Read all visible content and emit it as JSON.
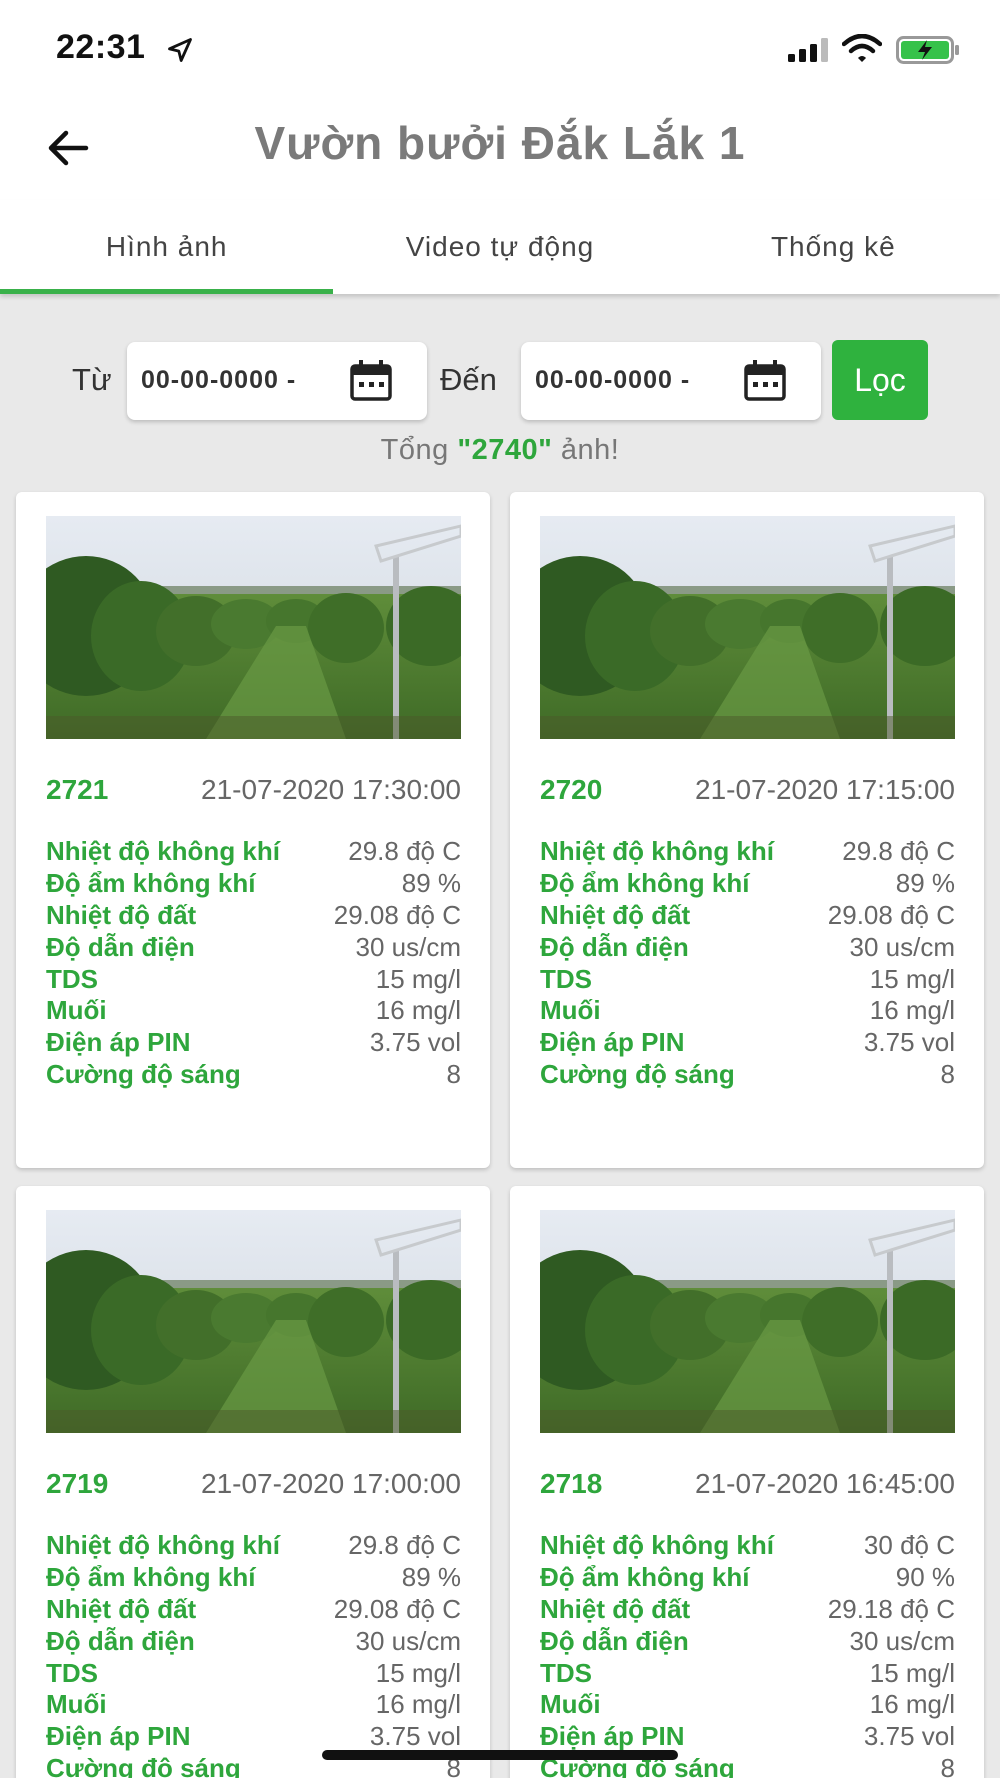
{
  "status_bar": {
    "time": "22:31",
    "icons": [
      "location-arrow-icon",
      "signal-icon",
      "wifi-icon",
      "battery-charging-icon"
    ]
  },
  "header": {
    "title": "Vườn bưởi Đắk Lắk 1",
    "back_icon": "arrow-left-icon"
  },
  "tabs": [
    {
      "label": "Hình ảnh",
      "active": true
    },
    {
      "label": "Video tự động",
      "active": false
    },
    {
      "label": "Thống kê",
      "active": false
    }
  ],
  "filter": {
    "from_label": "Từ",
    "to_label": "Đến",
    "from_value": "00-00-0000 -",
    "to_value": "00-00-0000 -",
    "button_label": "Lọc",
    "accent_color": "#2fb23e"
  },
  "total": {
    "prefix": "Tổng ",
    "count": "\"2740\"",
    "suffix": " ảnh!"
  },
  "cards": [
    {
      "id": "2721",
      "timestamp": "21-07-2020 17:30:00",
      "rows": [
        {
          "key": "Nhiệt độ không khí",
          "value": "29.8 độ C"
        },
        {
          "key": "Độ ẩm không khí",
          "value": "89 %"
        },
        {
          "key": "Nhiệt độ đất",
          "value": "29.08 độ C"
        },
        {
          "key": "Độ dẫn điện",
          "value": "30 us/cm"
        },
        {
          "key": "TDS",
          "value": "15 mg/l"
        },
        {
          "key": "Muối",
          "value": "16 mg/l"
        },
        {
          "key": "Điện áp PIN",
          "value": "3.75 vol"
        },
        {
          "key": "Cường độ sáng",
          "value": "8"
        }
      ]
    },
    {
      "id": "2720",
      "timestamp": "21-07-2020 17:15:00",
      "rows": [
        {
          "key": "Nhiệt độ không khí",
          "value": "29.8 độ C"
        },
        {
          "key": "Độ ẩm không khí",
          "value": "89 %"
        },
        {
          "key": "Nhiệt độ đất",
          "value": "29.08 độ C"
        },
        {
          "key": "Độ dẫn điện",
          "value": "30 us/cm"
        },
        {
          "key": "TDS",
          "value": "15 mg/l"
        },
        {
          "key": "Muối",
          "value": "16 mg/l"
        },
        {
          "key": "Điện áp PIN",
          "value": "3.75 vol"
        },
        {
          "key": "Cường độ sáng",
          "value": "8"
        }
      ]
    },
    {
      "id": "2719",
      "timestamp": "21-07-2020 17:00:00",
      "rows": [
        {
          "key": "Nhiệt độ không khí",
          "value": "29.8 độ C"
        },
        {
          "key": "Độ ẩm không khí",
          "value": "89 %"
        },
        {
          "key": "Nhiệt độ đất",
          "value": "29.08 độ C"
        },
        {
          "key": "Độ dẫn điện",
          "value": "30 us/cm"
        },
        {
          "key": "TDS",
          "value": "15 mg/l"
        },
        {
          "key": "Muối",
          "value": "16 mg/l"
        },
        {
          "key": "Điện áp PIN",
          "value": "3.75 vol"
        },
        {
          "key": "Cường độ sáng",
          "value": "8"
        }
      ]
    },
    {
      "id": "2718",
      "timestamp": "21-07-2020 16:45:00",
      "rows": [
        {
          "key": "Nhiệt độ không khí",
          "value": "30 độ C"
        },
        {
          "key": "Độ ẩm không khí",
          "value": "90 %"
        },
        {
          "key": "Nhiệt độ đất",
          "value": "29.18 độ C"
        },
        {
          "key": "Độ dẫn điện",
          "value": "30 us/cm"
        },
        {
          "key": "TDS",
          "value": "15 mg/l"
        },
        {
          "key": "Muối",
          "value": "16 mg/l"
        },
        {
          "key": "Điện áp PIN",
          "value": "3.75 vol"
        },
        {
          "key": "Cường độ sáng",
          "value": "8"
        }
      ]
    }
  ]
}
